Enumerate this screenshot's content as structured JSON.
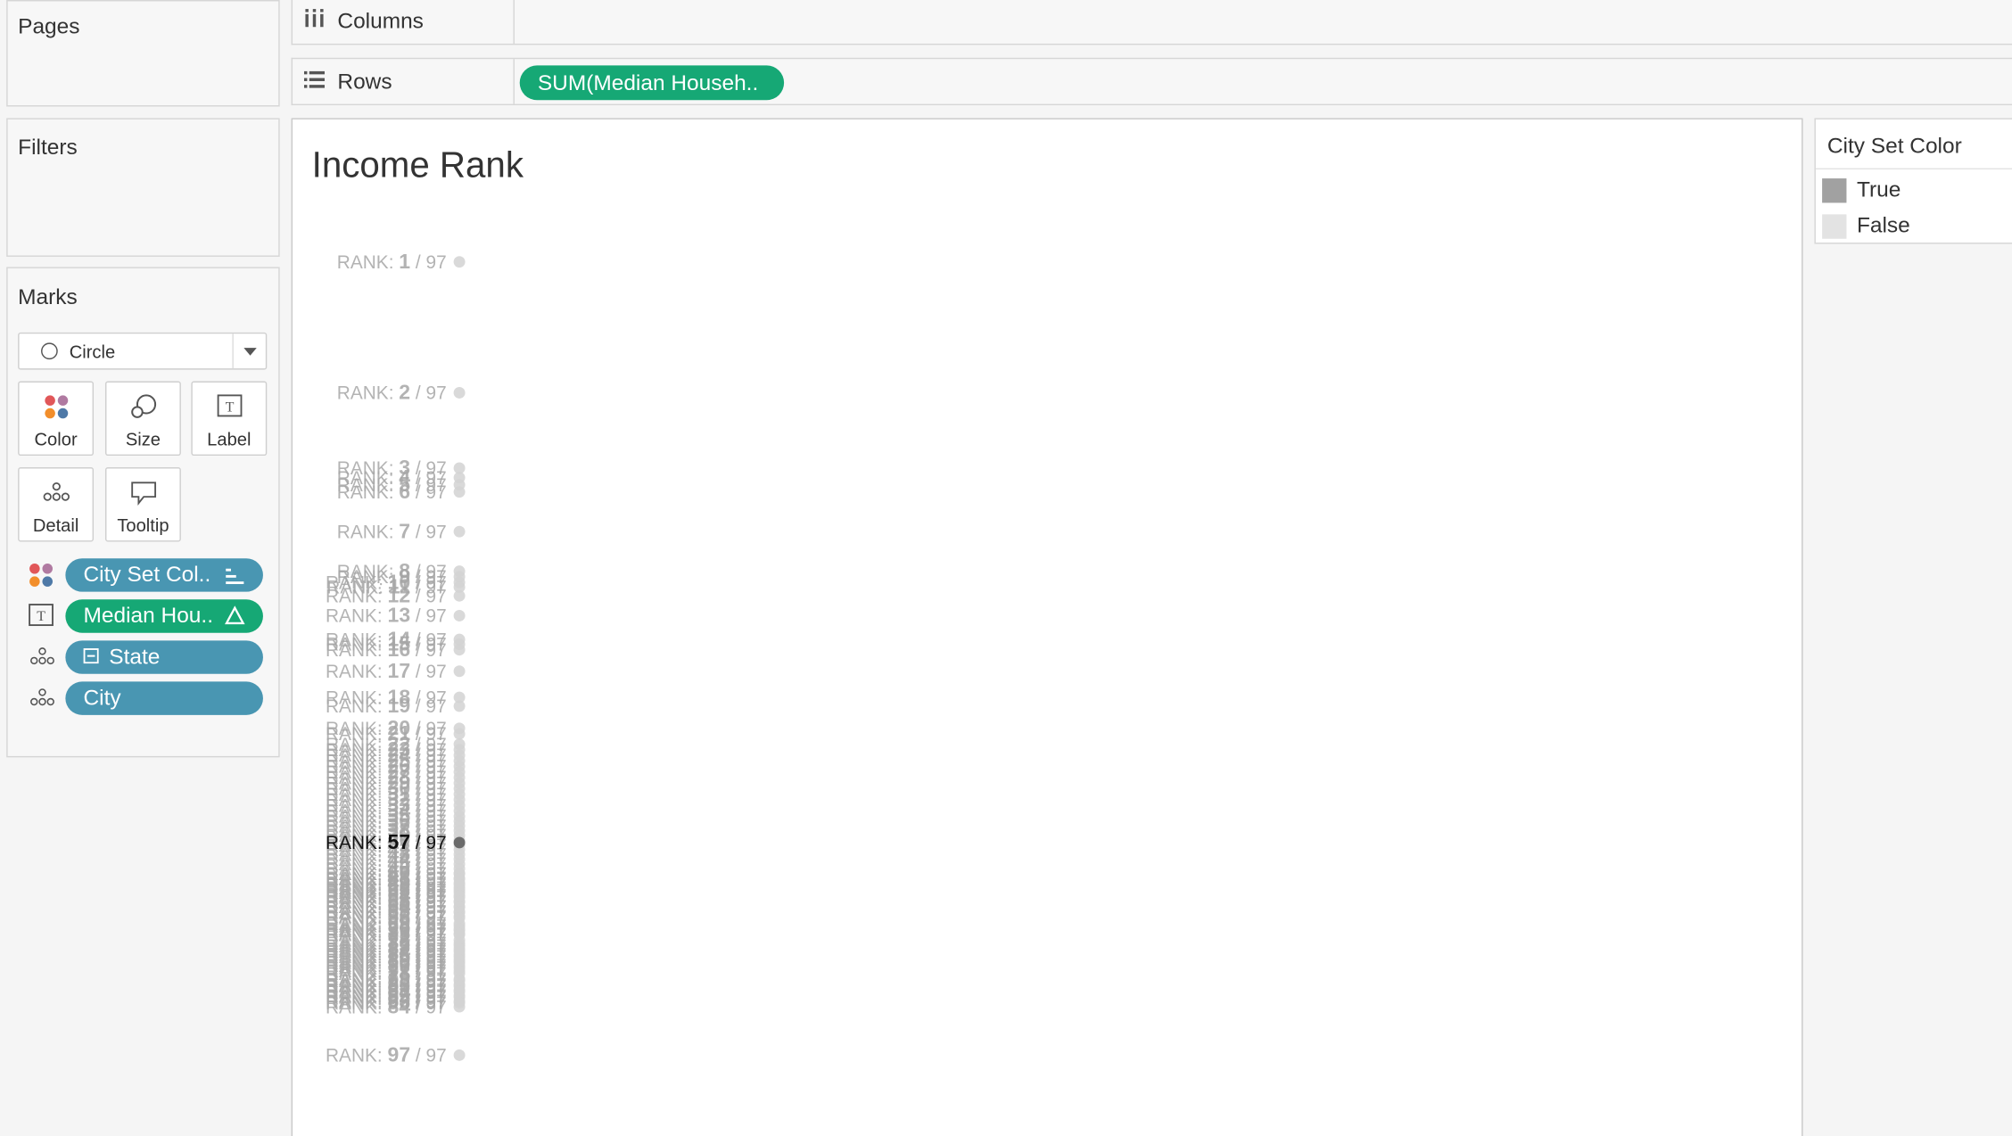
{
  "cards": {
    "pages": "Pages",
    "filters": "Filters",
    "marks": "Marks"
  },
  "marks": {
    "type": "Circle",
    "buttons": [
      {
        "label": "Color",
        "icon": "color-dots-icon"
      },
      {
        "label": "Size",
        "icon": "size-icon"
      },
      {
        "label": "Label",
        "icon": "label-icon"
      },
      {
        "label": "Detail",
        "icon": "detail-icon"
      },
      {
        "label": "Tooltip",
        "icon": "tooltip-icon"
      }
    ],
    "fields": [
      {
        "label": "City Set Col..",
        "kind": "color",
        "color": "#4996b2"
      },
      {
        "label": "Median Hou..",
        "kind": "label",
        "color": "#16a875"
      },
      {
        "label": "State",
        "kind": "detail",
        "color": "#4996b2"
      },
      {
        "label": "City",
        "kind": "detail",
        "color": "#4996b2"
      }
    ]
  },
  "shelves": {
    "columns": "Columns",
    "rows": "Rows",
    "rows_pill": "SUM(Median Househ.."
  },
  "view": {
    "title": "Income Rank",
    "label_prefix": "RANK:",
    "label_total": "97"
  },
  "legend": {
    "title": "City Set Color",
    "items": [
      {
        "label": "True",
        "color": "#a1a1a1"
      },
      {
        "label": "False",
        "color": "#e3e3e3"
      }
    ]
  },
  "chart_data": {
    "type": "scatter",
    "title": "Income Rank",
    "total": 97,
    "highlighted_rank": 57,
    "points": [
      {
        "rank": 1,
        "value": 1.0
      },
      {
        "rank": 2,
        "value": 0.835
      },
      {
        "rank": 3,
        "value": 0.74
      },
      {
        "rank": 4,
        "value": 0.728
      },
      {
        "rank": 5,
        "value": 0.719
      },
      {
        "rank": 6,
        "value": 0.71
      },
      {
        "rank": 7,
        "value": 0.66
      },
      {
        "rank": 8,
        "value": 0.61
      },
      {
        "rank": 9,
        "value": 0.603
      },
      {
        "rank": 10,
        "value": 0.596
      },
      {
        "rank": 11,
        "value": 0.59
      },
      {
        "rank": 12,
        "value": 0.579
      },
      {
        "rank": 13,
        "value": 0.554
      },
      {
        "rank": 14,
        "value": 0.524
      },
      {
        "rank": 15,
        "value": 0.518
      },
      {
        "rank": 16,
        "value": 0.511
      },
      {
        "rank": 17,
        "value": 0.484
      },
      {
        "rank": 18,
        "value": 0.451
      },
      {
        "rank": 19,
        "value": 0.44
      },
      {
        "rank": 20,
        "value": 0.412
      },
      {
        "rank": 21,
        "value": 0.405
      },
      {
        "rank": 22,
        "value": 0.392
      },
      {
        "rank": 23,
        "value": 0.385
      },
      {
        "rank": 24,
        "value": 0.378
      },
      {
        "rank": 25,
        "value": 0.371
      },
      {
        "rank": 26,
        "value": 0.364
      },
      {
        "rank": 27,
        "value": 0.357
      },
      {
        "rank": 28,
        "value": 0.35
      },
      {
        "rank": 29,
        "value": 0.343
      },
      {
        "rank": 30,
        "value": 0.336
      },
      {
        "rank": 31,
        "value": 0.329
      },
      {
        "rank": 32,
        "value": 0.322
      },
      {
        "rank": 33,
        "value": 0.315
      },
      {
        "rank": 34,
        "value": 0.308
      },
      {
        "rank": 35,
        "value": 0.301
      },
      {
        "rank": 36,
        "value": 0.295
      },
      {
        "rank": 37,
        "value": 0.289
      },
      {
        "rank": 38,
        "value": 0.283
      },
      {
        "rank": 39,
        "value": 0.277
      },
      {
        "rank": 40,
        "value": 0.271
      },
      {
        "rank": 41,
        "value": 0.265
      },
      {
        "rank": 42,
        "value": 0.259
      },
      {
        "rank": 43,
        "value": 0.253
      },
      {
        "rank": 44,
        "value": 0.247
      },
      {
        "rank": 45,
        "value": 0.241
      },
      {
        "rank": 46,
        "value": 0.235
      },
      {
        "rank": 47,
        "value": 0.229
      },
      {
        "rank": 48,
        "value": 0.223
      },
      {
        "rank": 49,
        "value": 0.217
      },
      {
        "rank": 50,
        "value": 0.211
      },
      {
        "rank": 51,
        "value": 0.205
      },
      {
        "rank": 52,
        "value": 0.199
      },
      {
        "rank": 53,
        "value": 0.193
      },
      {
        "rank": 54,
        "value": 0.187
      },
      {
        "rank": 55,
        "value": 0.181
      },
      {
        "rank": 56,
        "value": 0.175
      },
      {
        "rank": 57,
        "value": 0.268
      },
      {
        "rank": 58,
        "value": 0.163
      },
      {
        "rank": 59,
        "value": 0.157
      },
      {
        "rank": 60,
        "value": 0.229
      },
      {
        "rank": 61,
        "value": 0.222
      },
      {
        "rank": 62,
        "value": 0.215
      },
      {
        "rank": 63,
        "value": 0.208
      },
      {
        "rank": 64,
        "value": 0.201
      },
      {
        "rank": 65,
        "value": 0.194
      },
      {
        "rank": 66,
        "value": 0.187
      },
      {
        "rank": 67,
        "value": 0.18
      },
      {
        "rank": 68,
        "value": 0.173
      },
      {
        "rank": 69,
        "value": 0.166
      },
      {
        "rank": 70,
        "value": 0.159
      },
      {
        "rank": 71,
        "value": 0.152
      },
      {
        "rank": 72,
        "value": 0.145
      },
      {
        "rank": 73,
        "value": 0.138
      },
      {
        "rank": 74,
        "value": 0.131
      },
      {
        "rank": 75,
        "value": 0.124
      },
      {
        "rank": 76,
        "value": 0.117
      },
      {
        "rank": 77,
        "value": 0.11
      },
      {
        "rank": 78,
        "value": 0.103
      },
      {
        "rank": 79,
        "value": 0.096
      },
      {
        "rank": 80,
        "value": 0.089
      },
      {
        "rank": 81,
        "value": 0.082
      },
      {
        "rank": 82,
        "value": 0.075
      },
      {
        "rank": 83,
        "value": 0.068
      },
      {
        "rank": 84,
        "value": 0.061
      },
      {
        "rank": 85,
        "value": 0.153
      },
      {
        "rank": 86,
        "value": 0.141
      },
      {
        "rank": 87,
        "value": 0.134
      },
      {
        "rank": 88,
        "value": 0.127
      },
      {
        "rank": 89,
        "value": 0.12
      },
      {
        "rank": 90,
        "value": 0.113
      },
      {
        "rank": 91,
        "value": 0.106
      },
      {
        "rank": 92,
        "value": 0.094
      },
      {
        "rank": 93,
        "value": 0.087
      },
      {
        "rank": 94,
        "value": 0.08
      },
      {
        "rank": 95,
        "value": 0.073
      },
      {
        "rank": 96,
        "value": 0.066
      },
      {
        "rank": 97,
        "value": 0.0
      }
    ]
  }
}
